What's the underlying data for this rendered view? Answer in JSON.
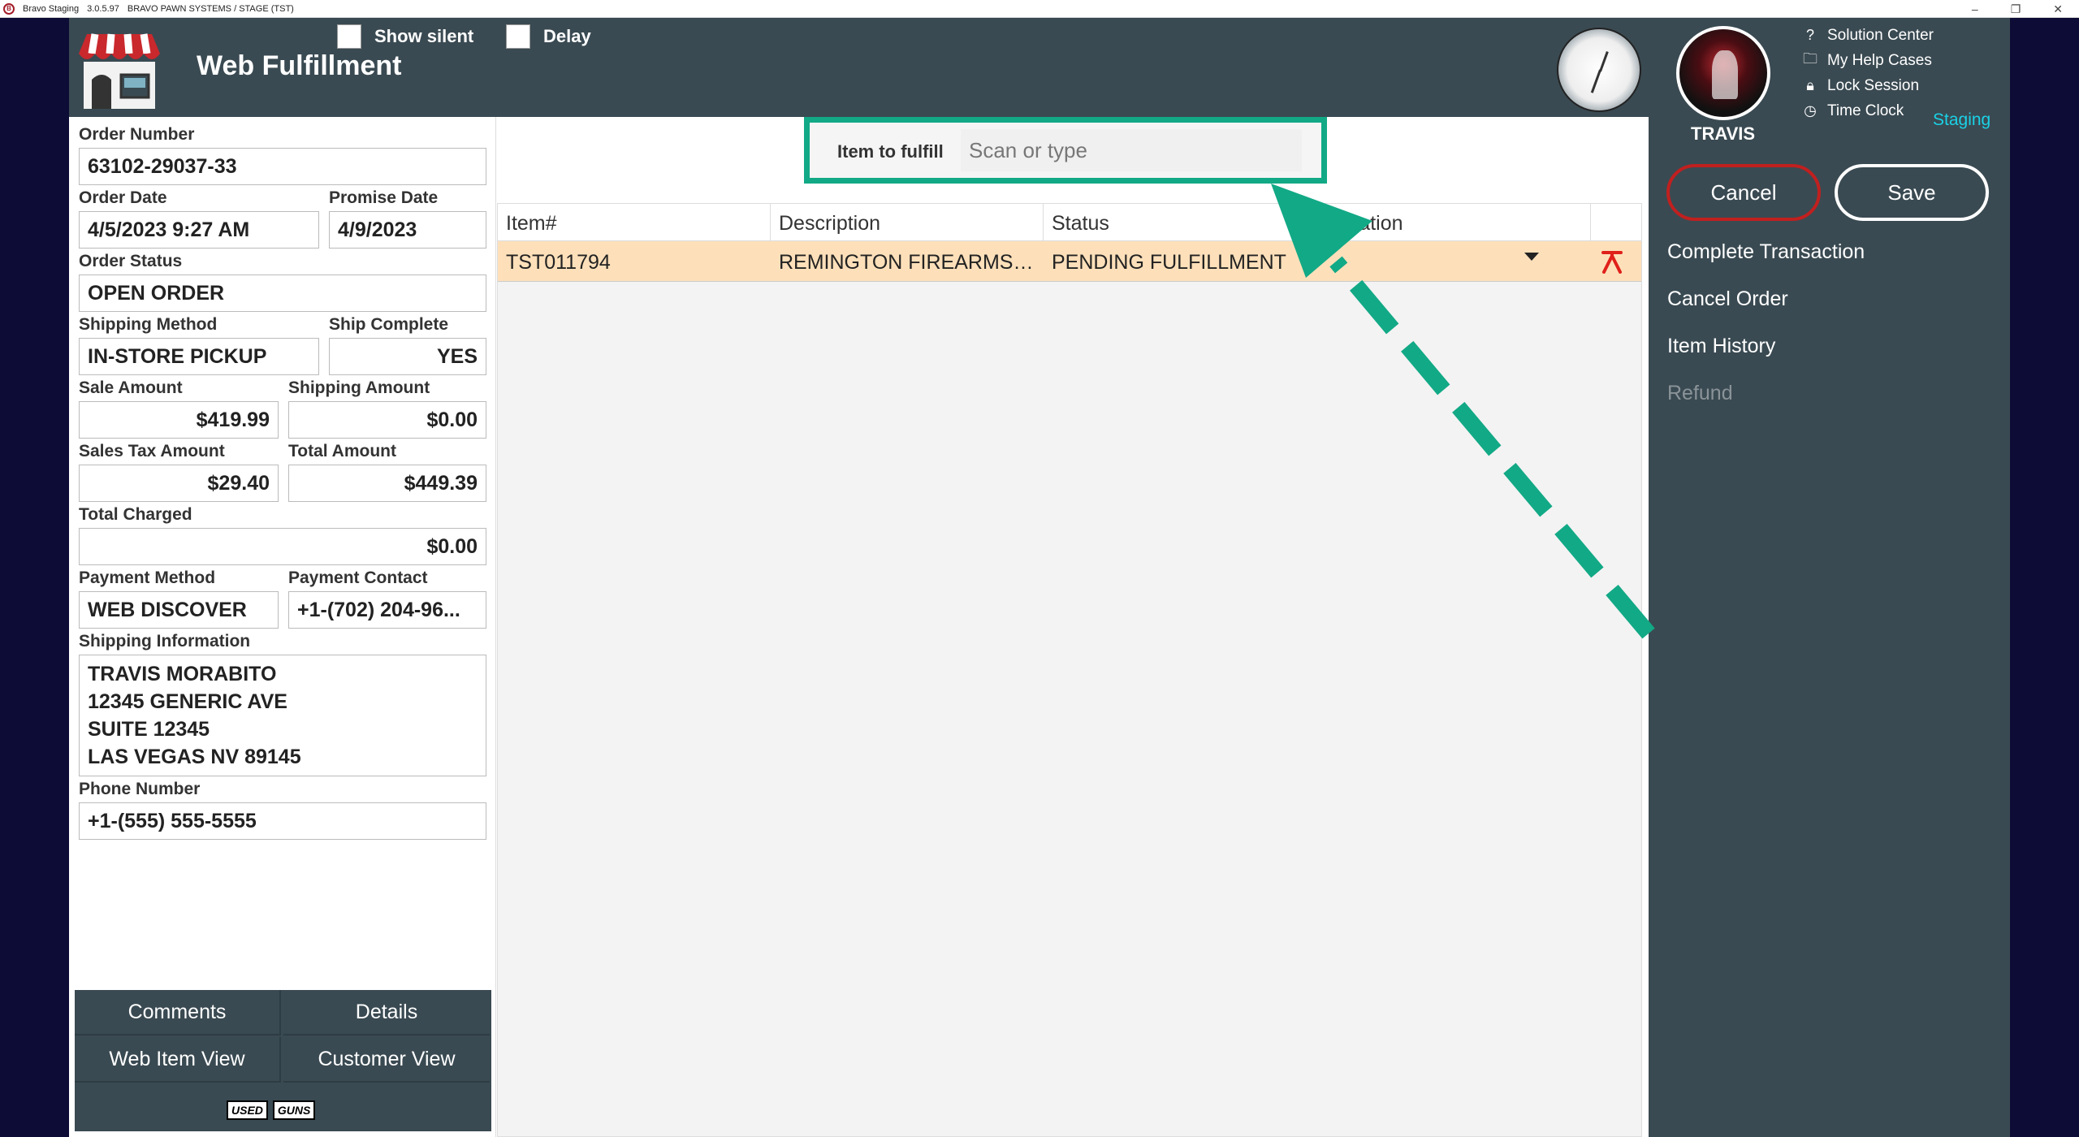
{
  "window": {
    "app_name": "Bravo Staging",
    "version": "3.0.5.97",
    "environment": "BRAVO PAWN SYSTEMS / STAGE (TST)",
    "logo_letter": "B"
  },
  "header": {
    "title": "Web Fulfillment",
    "show_silent_label": "Show silent",
    "delay_label": "Delay"
  },
  "order": {
    "order_number_label": "Order Number",
    "order_number": "63102-29037-33",
    "order_date_label": "Order Date",
    "order_date": "4/5/2023 9:27 AM",
    "promise_date_label": "Promise Date",
    "promise_date": "4/9/2023",
    "order_status_label": "Order Status",
    "order_status": "OPEN ORDER",
    "shipping_method_label": "Shipping Method",
    "shipping_method": "IN-STORE PICKUP",
    "ship_complete_label": "Ship Complete",
    "ship_complete": "YES",
    "sale_amount_label": "Sale Amount",
    "sale_amount": "$419.99",
    "shipping_amount_label": "Shipping Amount",
    "shipping_amount": "$0.00",
    "sales_tax_label": "Sales Tax Amount",
    "sales_tax": "$29.40",
    "total_amount_label": "Total Amount",
    "total_amount": "$449.39",
    "total_charged_label": "Total Charged",
    "total_charged": "$0.00",
    "payment_method_label": "Payment Method",
    "payment_method": "WEB DISCOVER",
    "payment_contact_label": "Payment Contact",
    "payment_contact": "+1-(702) 204-96...",
    "shipping_info_label": "Shipping Information",
    "shipping_info": [
      "TRAVIS MORABITO",
      "12345 GENERIC AVE",
      "SUITE 12345",
      "LAS VEGAS NV 89145"
    ],
    "phone_label": "Phone Number",
    "phone": "+1-(555) 555-5555"
  },
  "bottom_buttons": {
    "comments": "Comments",
    "details": "Details",
    "web_item_view": "Web Item View",
    "customer_view": "Customer View",
    "logo_used": "USED",
    "logo_guns": "GUNS"
  },
  "search": {
    "label": "Item to fulfill",
    "placeholder": "Scan or type"
  },
  "grid": {
    "columns": [
      "Item#",
      "Description",
      "Status",
      "Location"
    ],
    "rows": [
      {
        "item": "TST011794",
        "description": "REMINGTON FIREARMS &...",
        "status": "PENDING FULFILLMENT",
        "location": ""
      }
    ]
  },
  "sidebar": {
    "username": "TRAVIS",
    "top_menu": [
      {
        "label": "Solution Center",
        "icon": "help-icon"
      },
      {
        "label": "My Help Cases",
        "icon": "folder-icon"
      },
      {
        "label": "Lock Session",
        "icon": "lock-icon"
      },
      {
        "label": "Time Clock",
        "icon": "clock-icon"
      }
    ],
    "staging_label": "Staging",
    "cancel_label": "Cancel",
    "save_label": "Save",
    "menu": [
      {
        "label": "Complete Transaction",
        "enabled": true
      },
      {
        "label": "Cancel Order",
        "enabled": true
      },
      {
        "label": "Item History",
        "enabled": true
      },
      {
        "label": "Refund",
        "enabled": false
      }
    ]
  },
  "colors": {
    "header": "#3a4a52",
    "highlight": "#12a986",
    "row": "#fde0ba",
    "cancel_border": "#c0201f",
    "staging": "#1ad1e6"
  }
}
